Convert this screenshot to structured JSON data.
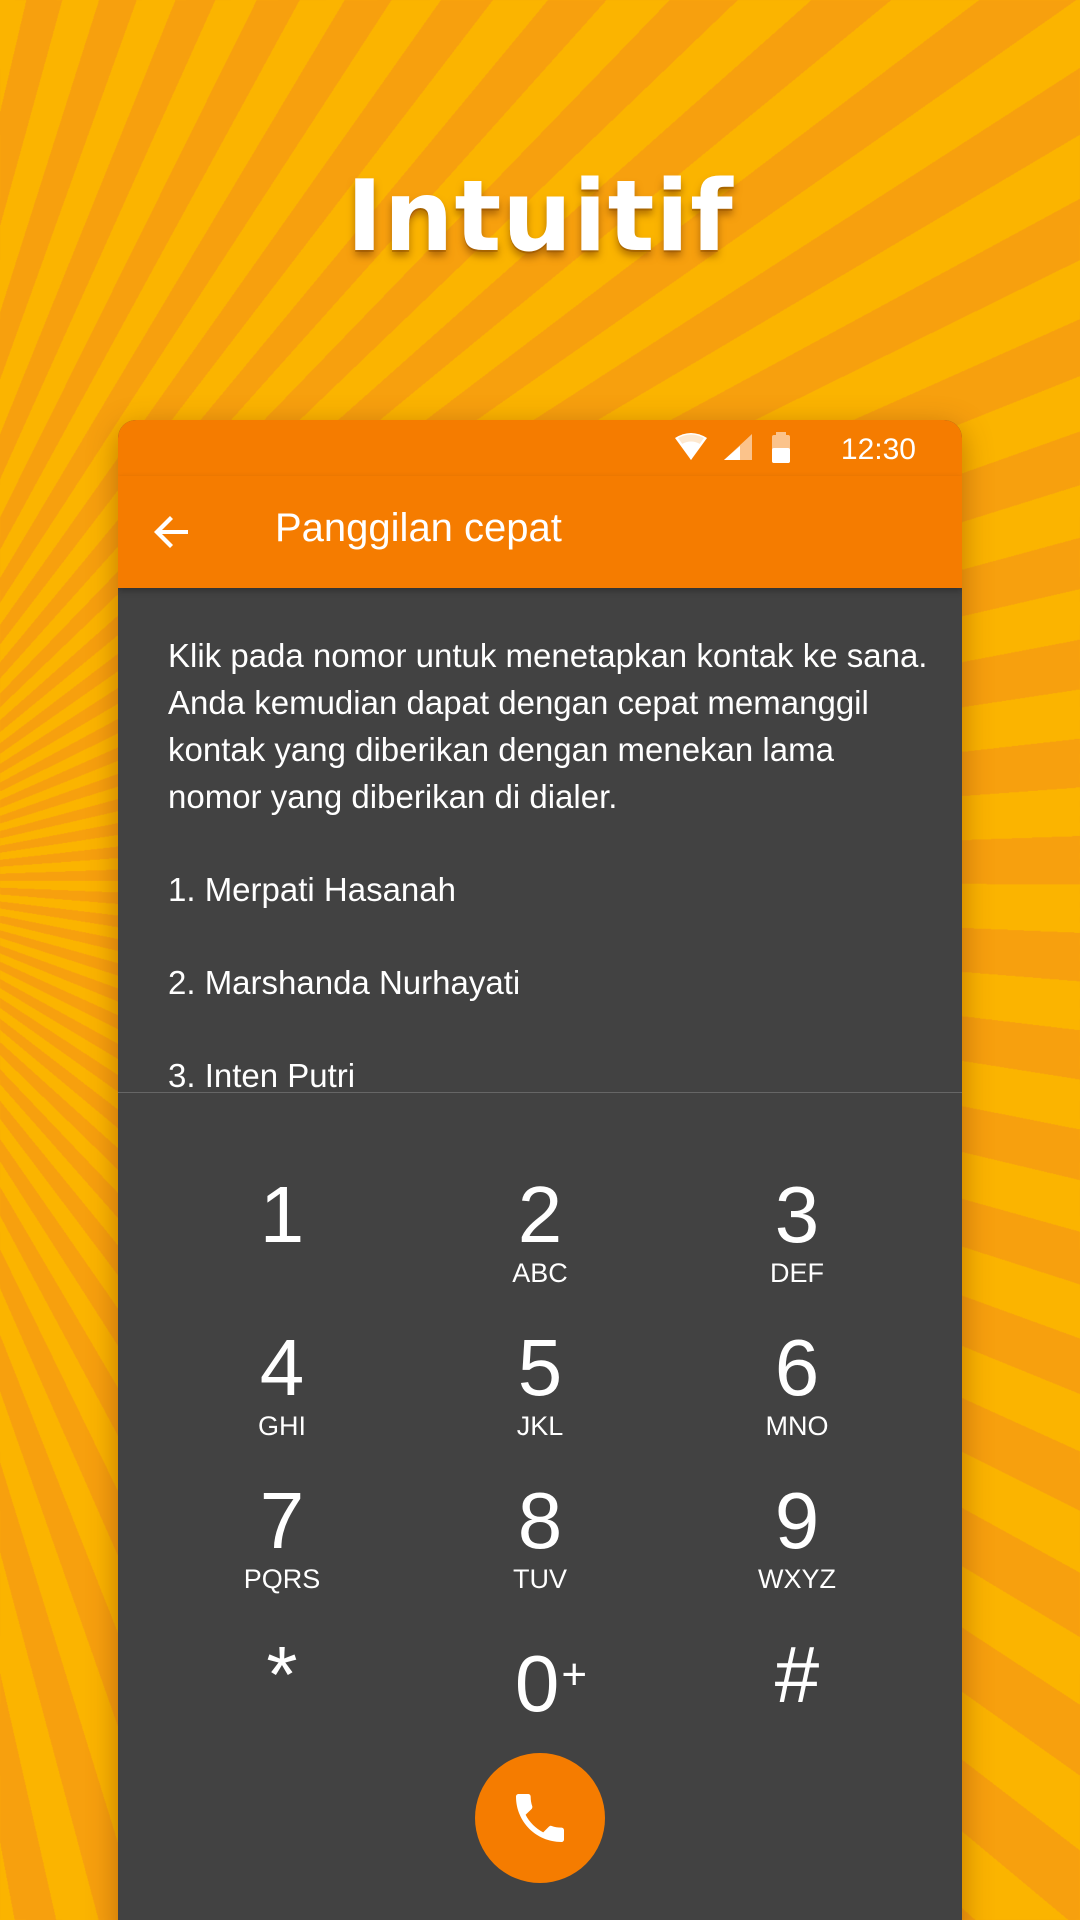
{
  "headline": "Intuitif",
  "status_bar": {
    "time": "12:30",
    "icons": [
      "wifi-icon",
      "cell-signal-icon",
      "battery-icon"
    ]
  },
  "toolbar": {
    "back_icon": "arrow-back-icon",
    "title": "Panggilan cepat"
  },
  "content": {
    "description": "Klik pada nomor untuk menetapkan kontak ke sana. Anda kemudian dapat dengan cepat memanggil kontak yang diberikan dengan menekan lama nomor yang diberikan di dialer.",
    "speed_dial": [
      "1. Merpati Hasanah",
      "2. Marshanda Nurhayati",
      "3. Inten Putri"
    ]
  },
  "dialpad": {
    "keys": [
      {
        "digit": "1",
        "letters": ""
      },
      {
        "digit": "2",
        "letters": "ABC"
      },
      {
        "digit": "3",
        "letters": "DEF"
      },
      {
        "digit": "4",
        "letters": "GHI"
      },
      {
        "digit": "5",
        "letters": "JKL"
      },
      {
        "digit": "6",
        "letters": "MNO"
      },
      {
        "digit": "7",
        "letters": "PQRS"
      },
      {
        "digit": "8",
        "letters": "TUV"
      },
      {
        "digit": "9",
        "letters": "WXYZ"
      },
      {
        "digit": "*",
        "letters": ""
      },
      {
        "digit": "0",
        "letters": "",
        "extra": "+"
      },
      {
        "digit": "#",
        "letters": ""
      }
    ],
    "call_icon": "phone-icon"
  },
  "colors": {
    "accent": "#f57c00",
    "panel": "#424242",
    "background": "#f99e10",
    "background_stripe": "#fbb400"
  }
}
